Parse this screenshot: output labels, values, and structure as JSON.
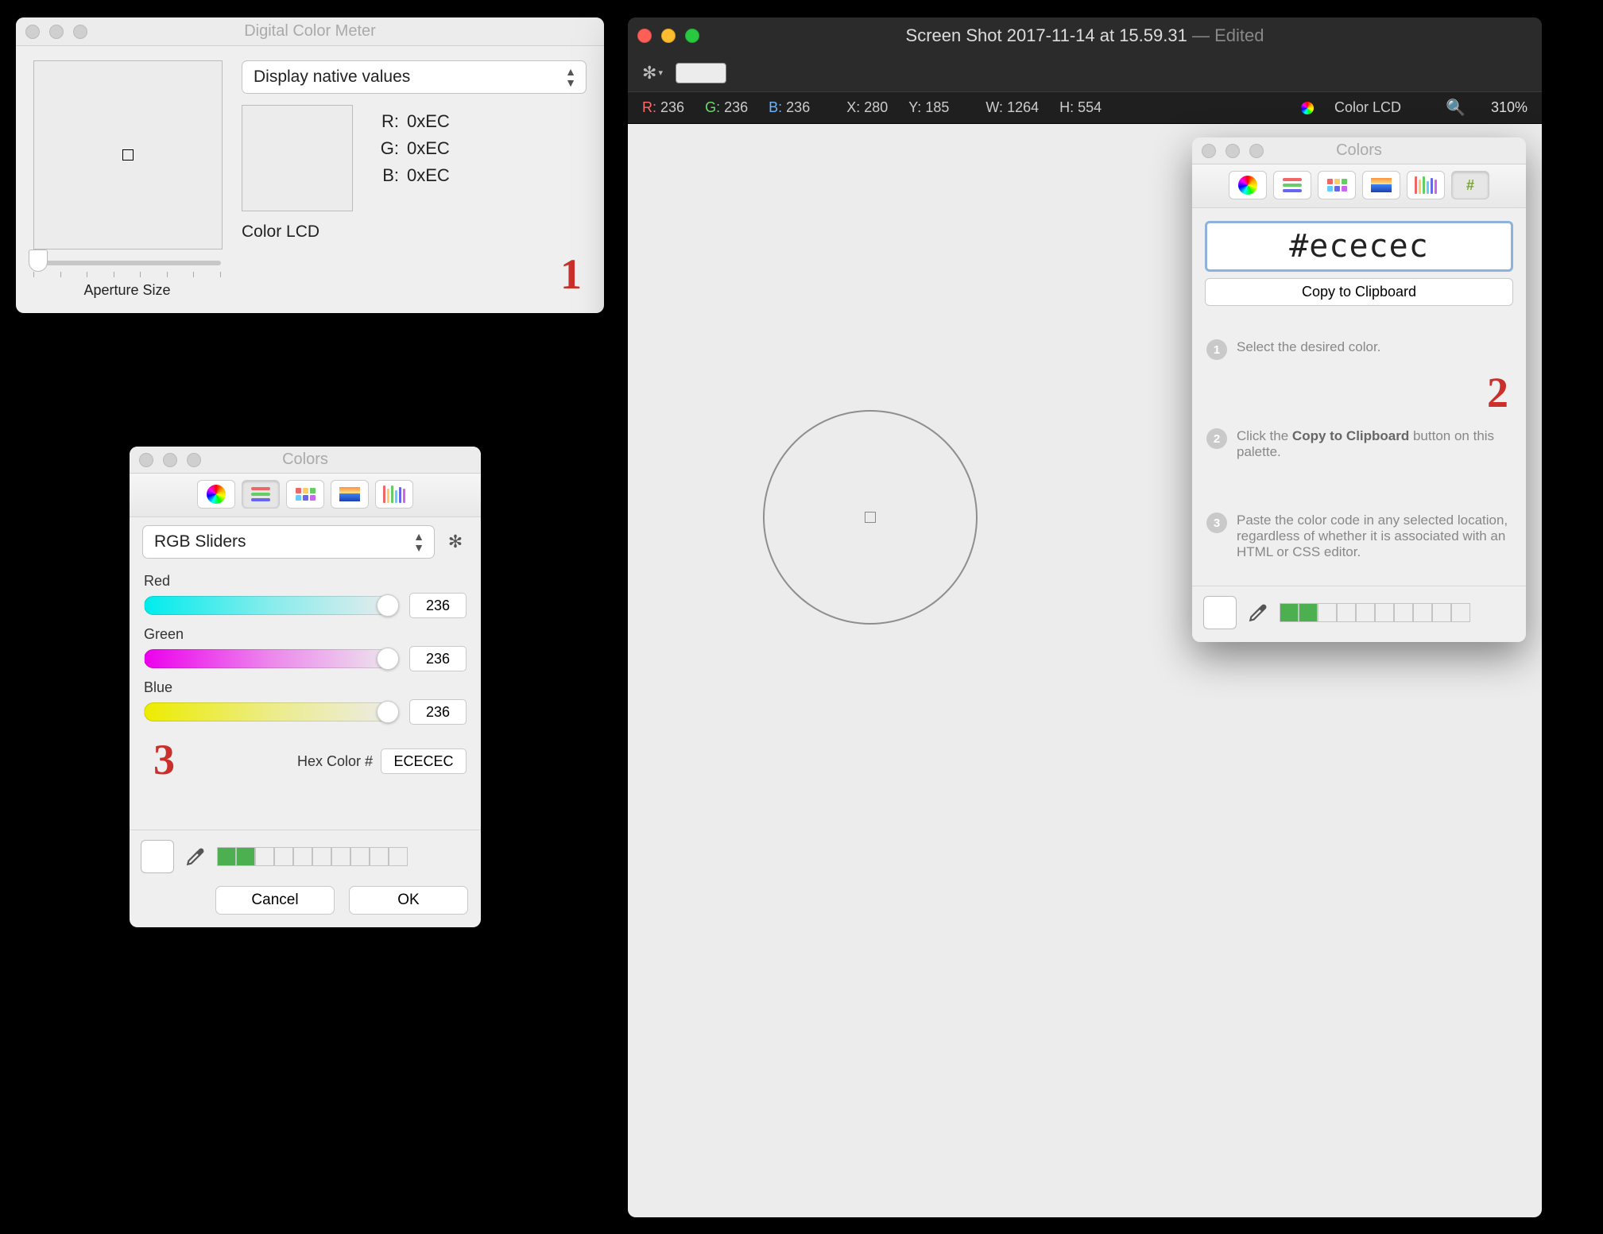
{
  "dcm": {
    "title": "Digital Color Meter",
    "mode": "Display native values",
    "r_label": "R:",
    "g_label": "G:",
    "b_label": "B:",
    "r_val": "0xEC",
    "g_val": "0xEC",
    "b_val": "0xEC",
    "profile": "Color LCD",
    "aperture_label": "Aperture Size",
    "annotation": "1"
  },
  "preview": {
    "title_main": "Screen Shot 2017-11-14 at 15.59.31",
    "title_suffix": " — Edited",
    "info": {
      "r_label": "R:",
      "r": "236",
      "g_label": "G:",
      "g": "236",
      "b_label": "B:",
      "b": "236",
      "x_label": "X:",
      "x": "280",
      "y_label": "Y:",
      "y": "185",
      "w_label": "W:",
      "w": "1264",
      "h_label": "H:",
      "h": "554",
      "profile": "Color LCD",
      "zoom": "310%"
    }
  },
  "colors2": {
    "title": "Colors",
    "hex_value": "#ececec",
    "copy_label": "Copy to Clipboard",
    "step1": "Select the desired color.",
    "step2_prefix": "Click the ",
    "step2_bold": "Copy to Clipboard",
    "step2_suffix": " button on this palette.",
    "step3": "Paste the color code in any selected location, regardless of whether it is associated with an HTML or CSS editor.",
    "annotation": "2"
  },
  "colors3": {
    "title": "Colors",
    "mode": "RGB Sliders",
    "red_label": "Red",
    "green_label": "Green",
    "blue_label": "Blue",
    "red_val": "236",
    "green_val": "236",
    "blue_val": "236",
    "hex_label": "Hex Color #",
    "hex_val": "ECECEC",
    "cancel": "Cancel",
    "ok": "OK",
    "annotation": "3"
  }
}
